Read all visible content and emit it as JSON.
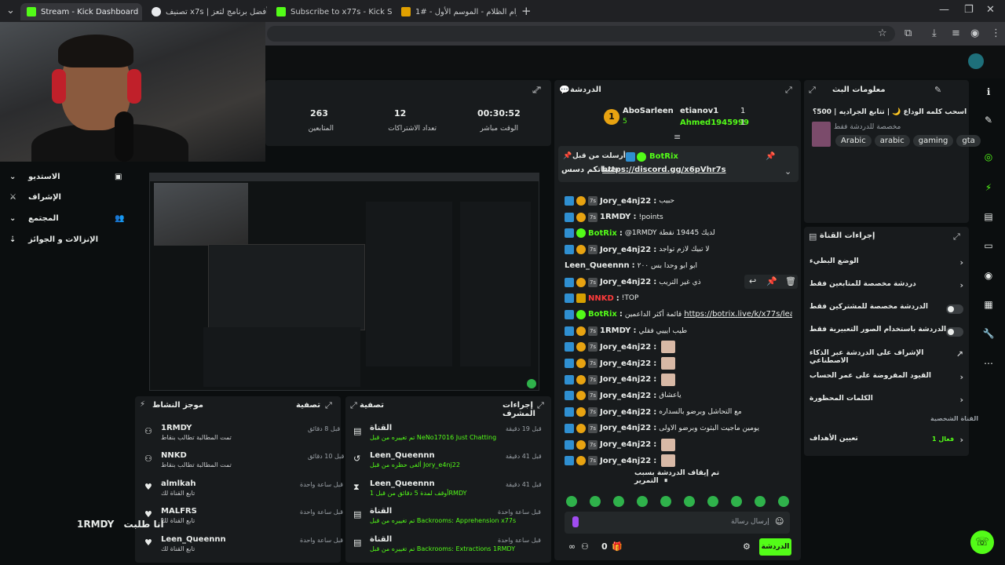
{
  "browser": {
    "tabs": [
      {
        "title": "Stream - Kick Dashboard",
        "color": "#53fc18"
      },
      {
        "title": "تصنيف x7s | أفضل برنامج لتعز...",
        "color": "#e8eaed"
      },
      {
        "title": "Subscribe to x77s - Kick Stream",
        "color": "#53fc18"
      },
      {
        "title": "أعوام الظلام - الموسم الأول - #1",
        "color": "#e0a000"
      }
    ],
    "new_tab": "+"
  },
  "stats": [
    {
      "value": "263",
      "label": "المتابعين"
    },
    {
      "value": "12",
      "label": "تعداد الاشتراكات"
    },
    {
      "value": "00:30:52",
      "label": "الوقت مباشر"
    }
  ],
  "sidebar": {
    "items": [
      "الاستديو",
      "الإشراف",
      "المجتمع",
      "الإنزالات و الجوائز"
    ]
  },
  "activity_feed": {
    "title": "موجز النشاط",
    "filter": "تصفية",
    "items": [
      {
        "name": "1RMDY",
        "sub": "تمت المطالبة تطالب بنقاط",
        "time": "قبل 8 دقائق"
      },
      {
        "name": "NNKD",
        "sub": "تمت المطالبة تطالب بنقاط",
        "time": "قبل 10 دقائق"
      },
      {
        "name": "almlkah",
        "sub": "تابع القناة لك",
        "time": "قبل ساعة واحدة"
      },
      {
        "name": "MALFRS",
        "sub": "تابع القناة لك",
        "time": "قبل ساعة واحدة"
      },
      {
        "name": "Leen_Queennn",
        "sub": "تابع القناة لك",
        "time": "قبل ساعة واحدة"
      }
    ]
  },
  "mod_actions": {
    "title": "إجراءات المشرف",
    "filter": "تصفية",
    "items": [
      {
        "name": "القناة",
        "sub": "تم تغييره من قبل NeNo17016 Just Chatting",
        "time": "قبل 19 دقيقة"
      },
      {
        "name": "Leen_Queennn",
        "sub": "ألغى حظره من قبل Jory_e4nj22",
        "time": "قبل 41 دقيقة"
      },
      {
        "name": "Leen_Queennn",
        "sub": "أوقف لمدة 5 دقائق من قبل 1RMDY",
        "time": "قبل 41 دقيقة"
      },
      {
        "name": "القناة",
        "sub": "تم تغييره من قبل Backrooms: Apprehension x77s",
        "time": "قبل ساعة واحدة"
      },
      {
        "name": "القناة",
        "sub": "تم تغييره من قبل Backrooms: Extractions 1RMDY",
        "time": "قبل ساعة واحدة"
      }
    ]
  },
  "overlay_text": {
    "user": "1RMDY",
    "text": "أنا طلبت"
  },
  "chat": {
    "title": "الدردشة",
    "leaderboard": [
      {
        "rank": "1",
        "name": "AboSarleen",
        "count": "5"
      },
      {
        "name": "etianov1",
        "count": "1"
      },
      {
        "name": "Ahmed1945999",
        "count": "1"
      }
    ],
    "pinned": {
      "by": "أرسلت من قبل",
      "user": "BotRix",
      "text": "حبيباتكم دسس",
      "link": "https://discord.gg/x6pVhr7s"
    },
    "messages": [
      {
        "user": "Jory_e4nj22",
        "text": "حبيب",
        "color": "#e9ecea"
      },
      {
        "user": "1RMDY",
        "text": "!points",
        "color": "#e9ecea"
      },
      {
        "user": "BotRix",
        "text": "@1RMDY لديك 19445 نقطة",
        "color": "#53fc18"
      },
      {
        "user": "Jory_e4nj22",
        "text": "لا تبيك لازم تواجد",
        "color": "#e9ecea"
      },
      {
        "user": "Leen_Queennn",
        "text": "ابو ابو وحدا بس ٢٠٠",
        "color": "#e9ecea"
      },
      {
        "user": "Jory_e4nj22",
        "text": "ذي غير التريب",
        "color": "#e9ecea"
      },
      {
        "user": "NNKD",
        "text": "!TOP",
        "color": "#ff3b3b"
      },
      {
        "user": "BotRix",
        "text": "قائمة أكثر الداعمين",
        "link": "https://botrix.live/k/x77s/leaderboard",
        "color": "#53fc18"
      },
      {
        "user": "1RMDY",
        "text": "طيب ايييي فقلي",
        "color": "#e9ecea"
      },
      {
        "user": "Jory_e4nj22",
        "text": "",
        "color": "#e9ecea"
      },
      {
        "user": "Jory_e4nj22",
        "text": "",
        "color": "#e9ecea"
      },
      {
        "user": "Jory_e4nj22",
        "text": "",
        "color": "#e9ecea"
      },
      {
        "user": "Jory_e4nj22",
        "text": "ياعشاق",
        "color": "#e9ecea"
      },
      {
        "user": "Jory_e4nj22",
        "text": "مع التحاشل وبرضو بالسداره",
        "color": "#e9ecea"
      },
      {
        "user": "Jory_e4nj22",
        "text": "يومين ماجيت البثوث وبرضو الاولى",
        "color": "#e9ecea"
      },
      {
        "user": "Jory_e4nj22",
        "text": "",
        "color": "#e9ecea"
      },
      {
        "user": "Jory_e4nj22",
        "text": "",
        "color": "#e9ecea"
      }
    ],
    "paused": "تم إيقاف الدردشة بسبب التمرير",
    "input_placeholder": "إرسال رسالة",
    "points": "0",
    "send_label": "الدردشة"
  },
  "stream_info": {
    "title": "معلومات البث",
    "stream_title": "اسحب كلمه الوداع 🌙 | تتابع الجراديه | 500؟",
    "subtitle": "مخصصة للدردشة فقط",
    "tags": [
      "gta",
      "gaming",
      "arabic",
      "Arabic"
    ]
  },
  "channel_actions": {
    "title": "إجراءات القناة",
    "items": [
      {
        "label": "الوضع البطيء",
        "control": "chevron"
      },
      {
        "label": "دردشة مخصصة للمتابعين فقط",
        "control": "chevron"
      },
      {
        "label": "الدردشة مخصصة للمشتركين فقط",
        "control": "toggle"
      },
      {
        "label": "الدردشة باستخدام الصور التعبيرية فقط",
        "control": "toggle"
      },
      {
        "label": "الإشراف على الدردشة عبر الذكاء الاصطناعي",
        "control": "link"
      },
      {
        "label": "القيود المفروضة على عمر الحساب",
        "control": "chevron"
      },
      {
        "label": "الكلمات المحظورة",
        "control": "chevron"
      }
    ],
    "section": "القناة الشخصية",
    "goals_label": "تعيين الأهداف",
    "goals_value": "1 فعال"
  },
  "colors": {
    "accent": "#53fc18",
    "panel": "#181b1d",
    "background": "#0b0e0f"
  }
}
